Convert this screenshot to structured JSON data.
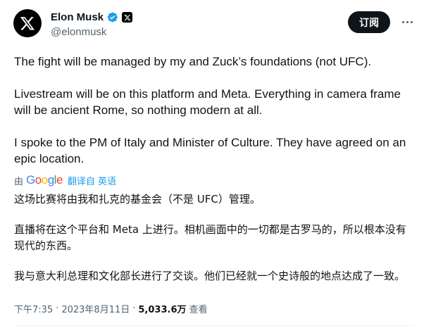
{
  "author": {
    "display_name": "Elon Musk",
    "handle": "@elonmusk",
    "verified_icon": "verified-badge-icon",
    "affiliate_icon": "x-logo-icon",
    "avatar_icon": "x-logo-icon"
  },
  "actions": {
    "subscribe_label": "订阅",
    "more_icon": "more-icon"
  },
  "tweet": {
    "paragraphs": [
      "The fight will be managed by my and Zuck’s foundations (not UFC).",
      "Livestream will be on this platform and Meta. Everything in camera frame will be ancient Rome, so nothing modern at all.",
      "I spoke to the PM of Italy and Minister of Culture. They have agreed on an epic location."
    ]
  },
  "translation": {
    "by_label": "由",
    "provider": "Google",
    "link_label": "翻译自 英语",
    "paragraphs": [
      "这场比赛将由我和扎克的基金会（不是 UFC）管理。",
      "直播将在这个平台和 Meta 上进行。相机画面中的一切都是古罗马的，所以根本没有现代的东西。",
      "我与意大利总理和文化部长进行了交谈。他们已经就一个史诗般的地点达成了一致。"
    ]
  },
  "meta": {
    "time": "下午7:35",
    "separator": "·",
    "date": "2023年8月11日",
    "views_count": "5,033.6万",
    "views_label": "查看"
  },
  "colors": {
    "text": "#0f1419",
    "secondary": "#536471",
    "link": "#1d9bf0",
    "verified": "#1d9bf0"
  }
}
